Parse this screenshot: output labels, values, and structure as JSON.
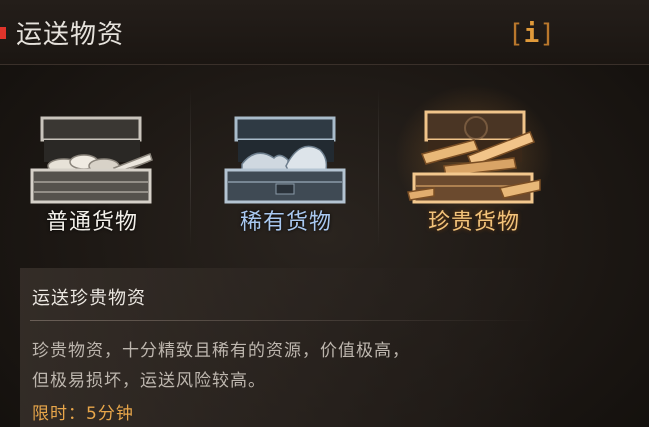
{
  "header": {
    "title": "运送物资",
    "info_icon": "info-icon"
  },
  "cargo_options": [
    {
      "label": "普通货物",
      "icon": "common-crate-icon",
      "color": "#f2efe9"
    },
    {
      "label": "稀有货物",
      "icon": "rare-crate-icon",
      "color": "#a9c8f0"
    },
    {
      "label": "珍贵货物",
      "icon": "precious-crate-icon",
      "color": "#f3c37a",
      "selected": true
    }
  ],
  "description": {
    "title": "运送珍贵物资",
    "line1": "珍贵物资，十分精致且稀有的资源，价值极高，",
    "line2": "但极易损坏，运送风险较高。",
    "time_limit": "限时：5分钟"
  },
  "colors": {
    "accent_red": "#e0342b",
    "accent_orange": "#e09a3a",
    "time_limit": "#e8a64a"
  }
}
